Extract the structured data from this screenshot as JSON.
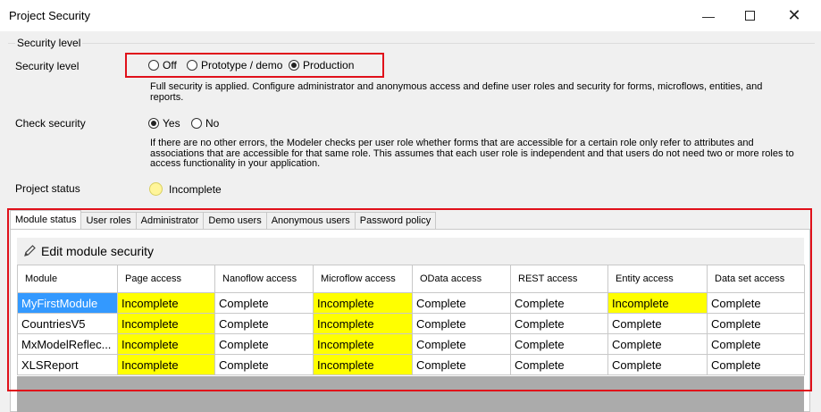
{
  "window": {
    "title": "Project Security"
  },
  "security": {
    "group_label": "Security level",
    "level_label": "Security level",
    "level_options": [
      "Off",
      "Prototype / demo",
      "Production"
    ],
    "level_selected": "Production",
    "level_description": "Full security is applied. Configure administrator and anonymous access and define user roles and security for forms, microflows, entities, and reports.",
    "check_label": "Check security",
    "check_options": [
      "Yes",
      "No"
    ],
    "check_selected": "Yes",
    "check_description": "If there are no other errors, the Modeler checks per user role whether forms that are accessible for a certain role only refer to attributes and associations that are accessible for that same role. This assumes that each user role is independent and that users do not need two or more roles to access functionality in your application.",
    "status_label": "Project status",
    "status_value": "Incomplete",
    "status_color": "#fff59a"
  },
  "tabs": [
    "Module status",
    "User roles",
    "Administrator",
    "Demo users",
    "Anonymous users",
    "Password policy"
  ],
  "active_tab": "Module status",
  "toolbar": {
    "edit_label": "Edit module security"
  },
  "table": {
    "headers": [
      "Module",
      "Page access",
      "Nanoflow access",
      "Microflow access",
      "OData access",
      "REST access",
      "Entity access",
      "Data set access"
    ],
    "rows": [
      [
        "MyFirstModule",
        "Incomplete",
        "Complete",
        "Incomplete",
        "Complete",
        "Complete",
        "Incomplete",
        "Complete"
      ],
      [
        "CountriesV5",
        "Incomplete",
        "Complete",
        "Incomplete",
        "Complete",
        "Complete",
        "Complete",
        "Complete"
      ],
      [
        "MxModelReflec...",
        "Incomplete",
        "Complete",
        "Incomplete",
        "Complete",
        "Complete",
        "Complete",
        "Complete"
      ],
      [
        "XLSReport",
        "Incomplete",
        "Complete",
        "Incomplete",
        "Complete",
        "Complete",
        "Complete",
        "Complete"
      ]
    ],
    "highlight_color": "#ffff00"
  }
}
